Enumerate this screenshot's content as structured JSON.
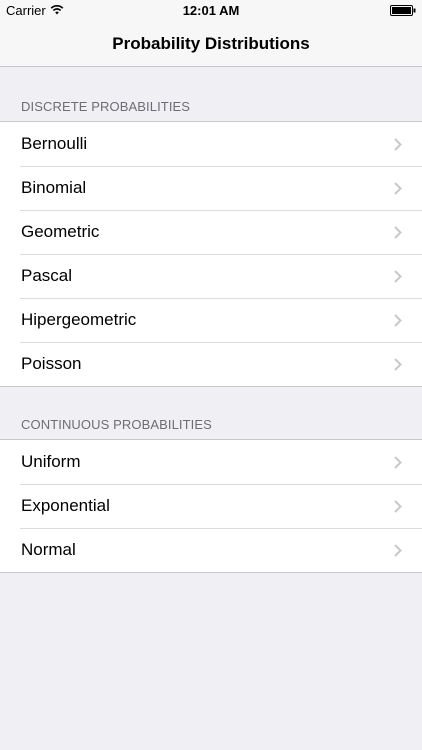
{
  "status_bar": {
    "carrier": "Carrier",
    "time": "12:01 AM",
    "wifi_icon": "wifi-icon",
    "battery_icon": "battery-icon"
  },
  "nav": {
    "title": "Probability Distributions"
  },
  "sections": [
    {
      "header": "DISCRETE PROBABILITIES",
      "items": [
        {
          "label": "Bernoulli",
          "icon": "chevron-right-icon"
        },
        {
          "label": "Binomial",
          "icon": "chevron-right-icon"
        },
        {
          "label": "Geometric",
          "icon": "chevron-right-icon"
        },
        {
          "label": "Pascal",
          "icon": "chevron-right-icon"
        },
        {
          "label": "Hipergeometric",
          "icon": "chevron-right-icon"
        },
        {
          "label": "Poisson",
          "icon": "chevron-right-icon"
        }
      ]
    },
    {
      "header": "CONTINUOUS PROBABILITIES",
      "items": [
        {
          "label": "Uniform",
          "icon": "chevron-right-icon"
        },
        {
          "label": "Exponential",
          "icon": "chevron-right-icon"
        },
        {
          "label": "Normal",
          "icon": "chevron-right-icon"
        }
      ]
    }
  ],
  "colors": {
    "background": "#efeff4",
    "cell_background": "#ffffff",
    "separator": "#c8c7cc",
    "section_header_text": "#6d6d72",
    "chevron": "#c7c7cc"
  }
}
